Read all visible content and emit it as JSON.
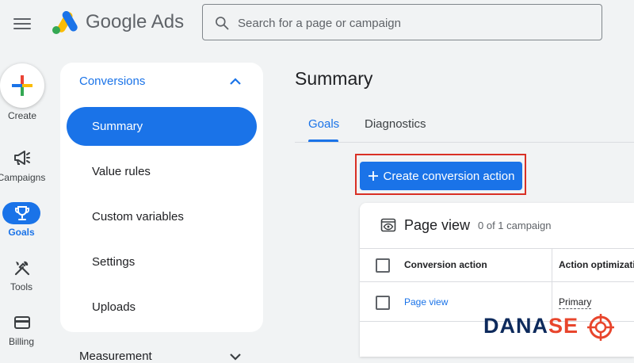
{
  "header": {
    "brand_google": "Google",
    "brand_ads": "Ads",
    "search_placeholder": "Search for a page or campaign"
  },
  "rail": {
    "create_label": "Create",
    "items": [
      {
        "label": "Campaigns",
        "icon": "megaphone-icon"
      },
      {
        "label": "Goals",
        "icon": "trophy-icon",
        "active": true
      },
      {
        "label": "Tools",
        "icon": "tools-icon"
      },
      {
        "label": "Billing",
        "icon": "credit-card-icon"
      }
    ]
  },
  "subnav": {
    "section": "Conversions",
    "items": [
      "Summary",
      "Value rules",
      "Custom variables",
      "Settings",
      "Uploads"
    ],
    "active": "Summary",
    "next_section": "Measurement"
  },
  "main": {
    "title": "Summary",
    "tabs": [
      "Goals",
      "Diagnostics"
    ],
    "active_tab": "Goals",
    "create_button": "Create conversion action",
    "card": {
      "title": "Page view",
      "subtitle": "0 of 1 campaign",
      "columns": [
        "Conversion action",
        "Action optimizatio"
      ],
      "rows": [
        {
          "action": "Page view",
          "optimization": "Primary"
        }
      ]
    }
  },
  "watermark": {
    "part1": "DANA",
    "part2": "SE"
  },
  "colors": {
    "accent": "#1a73e8",
    "highlight": "#d93025",
    "watermark_dark": "#0d2a5c",
    "watermark_orange": "#e8452c"
  }
}
